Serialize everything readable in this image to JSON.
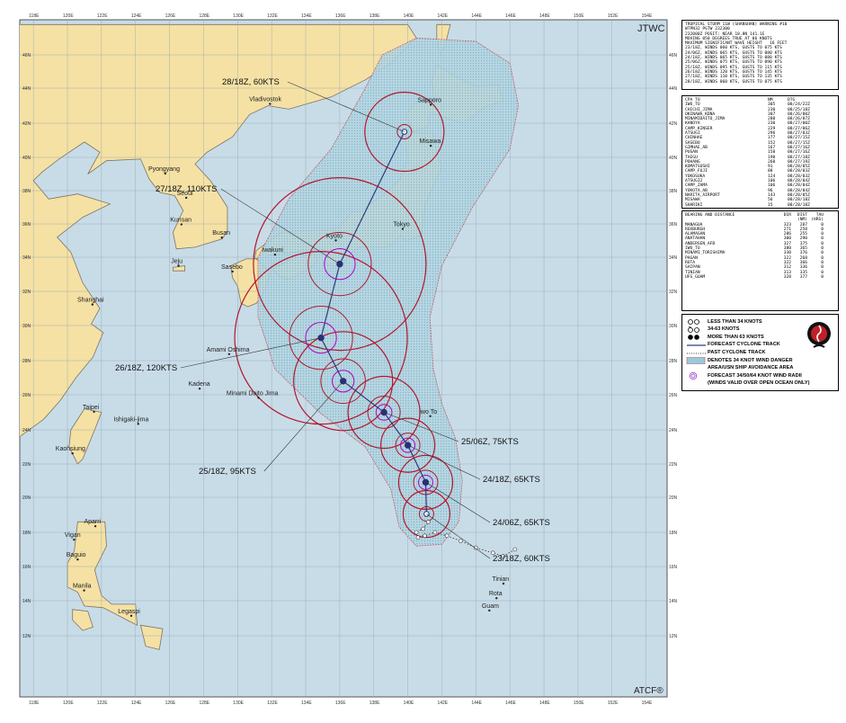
{
  "agency_label": "JTWC",
  "footer_label": "ATCF®",
  "lat_labels": [
    "46N",
    "44N",
    "42N",
    "40N",
    "38N",
    "36N",
    "34N",
    "32N",
    "30N",
    "28N",
    "26N",
    "24N",
    "22N",
    "20N",
    "18N",
    "16N",
    "14N",
    "12N"
  ],
  "lon_labels": [
    "118E",
    "120E",
    "122E",
    "124E",
    "126E",
    "128E",
    "130E",
    "132E",
    "134E",
    "136E",
    "138E",
    "140E",
    "142E",
    "144E",
    "146E",
    "148E",
    "150E",
    "152E",
    "154E"
  ],
  "places": [
    {
      "name": "Vladivostok",
      "lon": 131.9,
      "lat": 43.1
    },
    {
      "name": "Sapporo",
      "lon": 141.35,
      "lat": 43.06
    },
    {
      "name": "Misawa",
      "lon": 141.35,
      "lat": 40.68
    },
    {
      "name": "Pyongyang",
      "lon": 125.75,
      "lat": 39.03
    },
    {
      "name": "Seoul",
      "lon": 126.98,
      "lat": 37.57
    },
    {
      "name": "Kunsan",
      "lon": 126.7,
      "lat": 35.97
    },
    {
      "name": "Busan",
      "lon": 129.07,
      "lat": 35.18
    },
    {
      "name": "Tokyo",
      "lon": 139.7,
      "lat": 35.7
    },
    {
      "name": "Kyoto",
      "lon": 135.77,
      "lat": 35.01
    },
    {
      "name": "Iwakuni",
      "lon": 132.2,
      "lat": 34.15
    },
    {
      "name": "Sasebo",
      "lon": 129.7,
      "lat": 33.16
    },
    {
      "name": "Jeju",
      "lon": 126.53,
      "lat": 33.5
    },
    {
      "name": "Shanghai",
      "lon": 121.47,
      "lat": 31.23
    },
    {
      "name": "Amami Oshima",
      "lon": 129.5,
      "lat": 28.37
    },
    {
      "name": "Kadena",
      "lon": 127.77,
      "lat": 26.36
    },
    {
      "name": "Minami Daito Jima",
      "lon": 131.23,
      "lat": 25.83
    },
    {
      "name": "Iwo To",
      "lon": 141.32,
      "lat": 24.78
    },
    {
      "name": "Taipei",
      "lon": 121.56,
      "lat": 25.03
    },
    {
      "name": "Ishigaki-jima",
      "lon": 124.16,
      "lat": 24.34
    },
    {
      "name": "Kaohsiung",
      "lon": 120.3,
      "lat": 22.62
    },
    {
      "name": "Aparri",
      "lon": 121.64,
      "lat": 18.35
    },
    {
      "name": "Vigan",
      "lon": 120.39,
      "lat": 17.57
    },
    {
      "name": "Baguio",
      "lon": 120.6,
      "lat": 16.41
    },
    {
      "name": "Manila",
      "lon": 120.98,
      "lat": 14.6
    },
    {
      "name": "Legaspi",
      "lon": 123.75,
      "lat": 13.14
    },
    {
      "name": "Tinian",
      "lon": 145.62,
      "lat": 15.0
    },
    {
      "name": "Rota",
      "lon": 145.21,
      "lat": 14.15
    },
    {
      "name": "Guam",
      "lon": 144.79,
      "lat": 13.44
    }
  ],
  "forecast_labels": [
    {
      "text": "28/18Z,  60KTS"
    },
    {
      "text": "27/18Z, 110KTS"
    },
    {
      "text": "26/18Z, 120KTS"
    },
    {
      "text": "25/18Z,  95KTS"
    },
    {
      "text": "25/06Z,  75KTS"
    },
    {
      "text": "24/18Z,  65KTS"
    },
    {
      "text": "24/06Z,  65KTS"
    },
    {
      "text": "23/18Z,  60KTS"
    }
  ],
  "forecast_track": [
    {
      "lon": 141.1,
      "lat": 19.05,
      "int": 60
    },
    {
      "lon": 141.05,
      "lat": 20.9,
      "int": 65
    },
    {
      "lon": 140.0,
      "lat": 23.1,
      "int": 65
    },
    {
      "lon": 138.6,
      "lat": 25.0,
      "int": 75
    },
    {
      "lon": 136.2,
      "lat": 26.8,
      "int": 95
    },
    {
      "lon": 134.9,
      "lat": 29.3,
      "int": 120
    },
    {
      "lon": 136.0,
      "lat": 33.6,
      "int": 110
    },
    {
      "lon": 139.8,
      "lat": 41.5,
      "int": 60
    }
  ],
  "past_track": [
    {
      "lon": 146.3,
      "lat": 17.0
    },
    {
      "lon": 145.6,
      "lat": 16.6
    },
    {
      "lon": 145.0,
      "lat": 16.8
    },
    {
      "lon": 144.0,
      "lat": 17.1
    },
    {
      "lon": 143.1,
      "lat": 17.5
    },
    {
      "lon": 142.3,
      "lat": 17.8
    },
    {
      "lon": 141.6,
      "lat": 18.0
    },
    {
      "lon": 141.0,
      "lat": 17.8
    },
    {
      "lon": 140.6,
      "lat": 17.7
    },
    {
      "lon": 140.5,
      "lat": 18.0
    },
    {
      "lon": 140.9,
      "lat": 18.2
    },
    {
      "lon": 141.2,
      "lat": 18.6
    }
  ],
  "warning_text": [
    "TROPICAL STORM 11W (SHANSHAN) WARNING #10",
    "WTPN32 PGTW 232300",
    "232000Z POSIT: NEAR 18.8N 141.1E",
    "MOVING 050 DEGREES TRUE AT 06 KNOTS",
    "MAXIMUM SIGNIFICANT WAVE HEIGHT   16 FEET",
    "23/18Z, WINDS 060 KTS, GUSTS TO 075 KTS",
    "24/06Z, WINDS 065 KTS, GUSTS TO 080 KTS",
    "24/18Z, WINDS 065 KTS, GUSTS TO 080 KTS",
    "25/06Z, WINDS 075 KTS, GUSTS TO 090 KTS",
    "25/18Z, WINDS 095 KTS, GUSTS TO 115 KTS",
    "26/18Z, WINDS 120 KTS, GUSTS TO 145 KTS",
    "27/18Z, WINDS 110 KTS, GUSTS TO 135 KTS",
    "28/18Z, WINDS 060 KTS, GUSTS TO 075 KTS"
  ],
  "cpa_header": [
    "CPA TO",
    "NM",
    "DTG"
  ],
  "cpa_rows": [
    [
      "IWO_TO",
      "305",
      "08/24/22Z"
    ],
    [
      "CHICHI_JIMA",
      "230",
      "08/25/18Z"
    ],
    [
      "OKINAWA_KDNA",
      "307",
      "08/26/00Z"
    ],
    [
      "MINAMIDAITO_JIMA",
      "280",
      "08/26/07Z"
    ],
    [
      "KANOYA",
      "230",
      "08/27/00Z"
    ],
    [
      "CAMP_KINSER",
      "229",
      "08/27/06Z"
    ],
    [
      "ATSUGI",
      "296",
      "08/27/03Z"
    ],
    [
      "CHINHAE",
      "177",
      "08/27/15Z"
    ],
    [
      "SASEBO",
      "152",
      "08/27/15Z"
    ],
    [
      "GIMHAE_AB",
      "167",
      "08/27/16Z"
    ],
    [
      "PUSAN",
      "158",
      "08/27/16Z"
    ],
    [
      "TAEGU",
      "190",
      "08/27/18Z"
    ],
    [
      "POHANG",
      "260",
      "08/27/19Z"
    ],
    [
      "KOMATSUSHI",
      "91",
      "08/28/05Z"
    ],
    [
      "CAMP_FUJI",
      "88",
      "08/28/03Z"
    ],
    [
      "YOKOSUKA",
      "124",
      "08/28/03Z"
    ],
    [
      "ATSUGI2",
      "106",
      "08/28/04Z"
    ],
    [
      "CAMP_ZAMA",
      "106",
      "08/28/04Z"
    ],
    [
      "YOKOTA_AB",
      "96",
      "08/28/04Z"
    ],
    [
      "NARITA_AIRPORT",
      "143",
      "08/28/05Z"
    ],
    [
      "MISAWA",
      "56",
      "08/28/18Z"
    ],
    [
      "SHARIKI",
      "15",
      "08/28/18Z"
    ]
  ],
  "bearing_header": [
    "BEARING AND DISTANCE",
    "DIR",
    "DIST",
    "TAU"
  ],
  "bearing_subheader": [
    "",
    "",
    "(NM)",
    "(HRS)"
  ],
  "bearing_rows": [
    [
      "MANAGUA",
      "323",
      "287",
      "0"
    ],
    [
      "ROXBURGH",
      "271",
      "258",
      "0"
    ],
    [
      "ALAMAGAN",
      "286",
      "255",
      "0"
    ],
    [
      "ANATAHAN",
      "300",
      "290",
      "0"
    ],
    [
      "ANDERSEN_AFB",
      "327",
      "375",
      "0"
    ],
    [
      "IWO_TO",
      "380",
      "365",
      "0"
    ],
    [
      "MINAMI_TORISHIMA",
      "330",
      "376",
      "0"
    ],
    [
      "PAGAN",
      "322",
      "268",
      "0"
    ],
    [
      "ROTA",
      "322",
      "366",
      "0"
    ],
    [
      "SAIPAN",
      "312",
      "336",
      "0"
    ],
    [
      "TINIAN",
      "313",
      "335",
      "0"
    ],
    [
      "UFS_GUAM",
      "328",
      "377",
      "0"
    ]
  ],
  "legend_items": [
    {
      "label": "LESS THAN 34 KNOTS",
      "symbol": "circle-open"
    },
    {
      "label": "34-63 KNOTS",
      "symbol": "storm-open"
    },
    {
      "label": "MORE THAN 63 KNOTS",
      "symbol": "typhoon-filled"
    },
    {
      "label": "FORECAST CYCLONE TRACK",
      "symbol": "solid-line"
    },
    {
      "label": "PAST CYCLONE TRACK",
      "symbol": "dotted-line"
    },
    {
      "label": "DENOTES 34 KNOT WIND DANGER",
      "symbol": "danger-area"
    },
    {
      "label": "AREA/USN SHIP AVOIDANCE AREA",
      "symbol": "none"
    },
    {
      "label": "FORECAST 34/50/64 KNOT WIND RADII",
      "symbol": "radii"
    },
    {
      "label": "(WINDS VALID OVER OPEN OCEAN ONLY)",
      "symbol": "none"
    }
  ],
  "colors": {
    "ocean": "#c8dce8",
    "land": "#f5e1a4",
    "coast": "#7a7463",
    "grid": "#8fa3b3",
    "danger": "#9fc8d7",
    "r34": "#b3162d",
    "r50": "#3a3f9f",
    "r64": "#b200c8",
    "track": "#303a7a"
  }
}
